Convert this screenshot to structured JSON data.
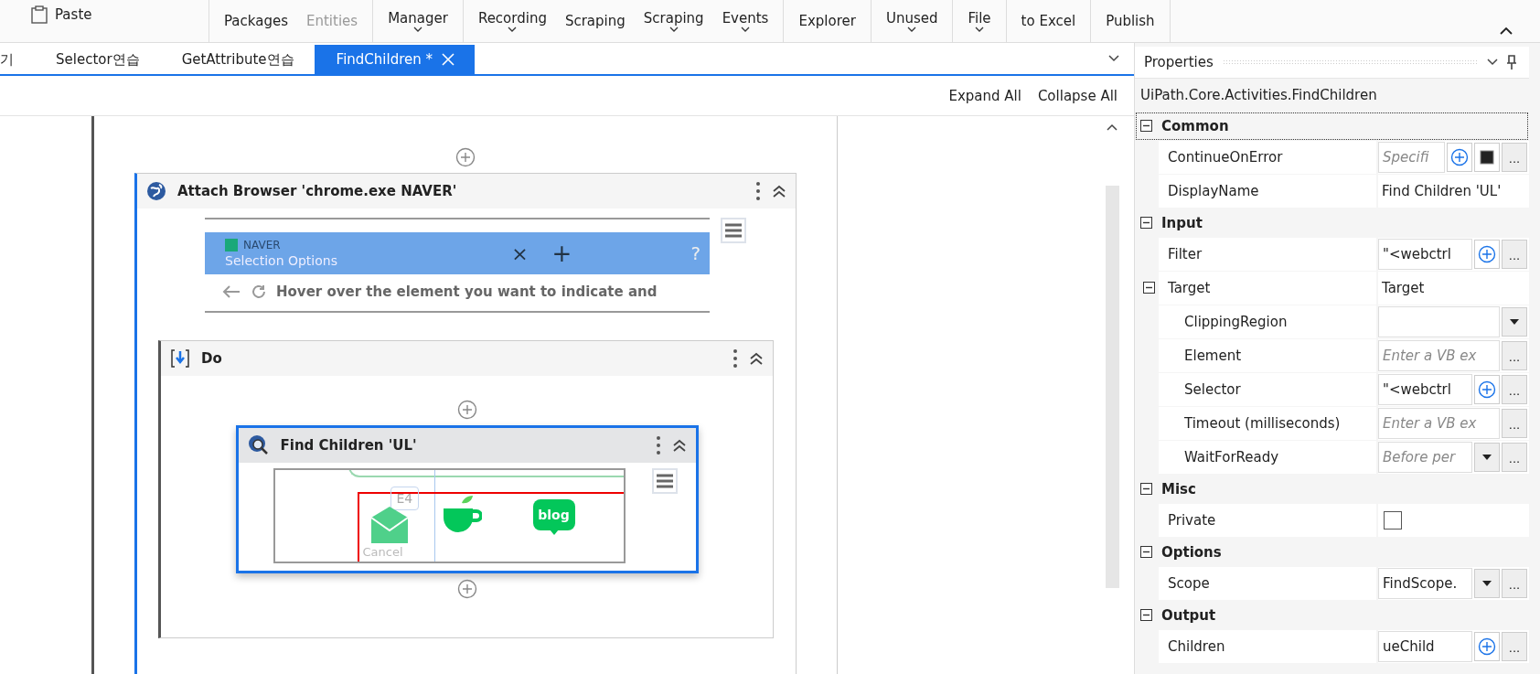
{
  "toolbar": {
    "groups": [
      [
        {
          "label": "Paste",
          "kind": "icon",
          "menu": false,
          "disabled": false
        }
      ],
      [
        {
          "label": "Packages",
          "kind": "text",
          "menu": false,
          "disabled": false
        },
        {
          "label": "Entities",
          "kind": "text",
          "menu": false,
          "disabled": true
        }
      ],
      [
        {
          "label": "Manager",
          "kind": "text",
          "menu": true,
          "disabled": false
        }
      ],
      [
        {
          "label": "Recording",
          "kind": "text",
          "menu": true,
          "disabled": false
        },
        {
          "label": "Scraping",
          "kind": "text",
          "menu": false,
          "disabled": false
        },
        {
          "label": "Scraping",
          "kind": "text",
          "menu": true,
          "disabled": false
        },
        {
          "label": "Events",
          "kind": "text",
          "menu": true,
          "disabled": false
        }
      ],
      [
        {
          "label": "Explorer",
          "kind": "text",
          "menu": false,
          "disabled": false
        }
      ],
      [
        {
          "label": "Unused",
          "kind": "text",
          "menu": true,
          "disabled": false
        }
      ],
      [
        {
          "label": "File",
          "kind": "text",
          "menu": true,
          "disabled": false
        }
      ],
      [
        {
          "label": "to Excel",
          "kind": "text",
          "menu": false,
          "disabled": false
        }
      ],
      [
        {
          "label": "Publish",
          "kind": "text",
          "menu": false,
          "disabled": false
        }
      ]
    ]
  },
  "tabs": [
    {
      "label": "기",
      "selected": false
    },
    {
      "label": "Selector연습",
      "selected": false
    },
    {
      "label": "GetAttribute연습",
      "selected": false
    },
    {
      "label": "FindChildren *",
      "selected": true
    }
  ],
  "designer": {
    "actions": [
      "Expand All",
      "Collapse All"
    ],
    "attach": {
      "title": "Attach Browser 'chrome.exe  NAVER'",
      "preview": {
        "tab_title": "NAVER",
        "overlay_title": "Selection Options",
        "close": "×",
        "new_tab": "+",
        "help": "?",
        "hint": "Hover over the element you want to indicate and"
      },
      "do": {
        "title": "Do",
        "find": {
          "title": "Find Children 'UL'",
          "selected": true,
          "preview": {
            "key_hint": "E4",
            "cancel": "Cancel",
            "logo_text": "blog"
          }
        }
      }
    }
  },
  "properties": {
    "title": "Properties",
    "type_name": "UiPath.Core.Activities.FindChildren",
    "categories": [
      {
        "name": "Common",
        "expanded": true,
        "selected": true,
        "items": [
          {
            "name": "ContinueOnError",
            "kind": "expr",
            "placeholder": "Specifi",
            "buttons": [
              {
                "kind": "add"
              },
              {
                "kind": "swatch"
              },
              {
                "kind": "more",
                "label": "..."
              }
            ]
          },
          {
            "name": "DisplayName",
            "kind": "text",
            "value": "Find Children 'UL'"
          }
        ]
      },
      {
        "name": "Input",
        "expanded": true,
        "selected": false,
        "items": [
          {
            "name": "Filter",
            "kind": "expr",
            "value": "\"<webctrl",
            "buttons": [
              {
                "kind": "add"
              },
              {
                "kind": "more",
                "label": "..."
              }
            ]
          },
          {
            "name": "Target",
            "kind": "text",
            "value": "Target",
            "expanded": true,
            "children": [
              {
                "name": "ClippingRegion",
                "kind": "expr",
                "buttons": [
                  {
                    "kind": "dropdown"
                  }
                ]
              },
              {
                "name": "Element",
                "kind": "expr",
                "placeholder": "Enter a VB ex",
                "buttons": [
                  {
                    "kind": "more",
                    "label": "..."
                  }
                ]
              },
              {
                "name": "Selector",
                "kind": "expr",
                "value": "\"<webctrl",
                "buttons": [
                  {
                    "kind": "add"
                  },
                  {
                    "kind": "more",
                    "label": "..."
                  }
                ]
              },
              {
                "name": "Timeout (milliseconds)",
                "kind": "expr",
                "placeholder": "Enter a VB ex",
                "buttons": [
                  {
                    "kind": "more",
                    "label": "..."
                  }
                ]
              },
              {
                "name": "WaitForReady",
                "kind": "expr",
                "placeholder": "Before per",
                "buttons": [
                  {
                    "kind": "dropdown"
                  },
                  {
                    "kind": "more",
                    "label": "..."
                  }
                ]
              }
            ]
          }
        ]
      },
      {
        "name": "Misc",
        "expanded": true,
        "selected": false,
        "items": [
          {
            "name": "Private",
            "kind": "checkbox",
            "checked": false
          }
        ]
      },
      {
        "name": "Options",
        "expanded": true,
        "selected": false,
        "items": [
          {
            "name": "Scope",
            "kind": "expr",
            "value": "FindScope.",
            "buttons": [
              {
                "kind": "dropdown"
              },
              {
                "kind": "more",
                "label": "..."
              }
            ]
          }
        ]
      },
      {
        "name": "Output",
        "expanded": true,
        "selected": false,
        "items": [
          {
            "name": "Children",
            "kind": "expr",
            "value": "ueChild",
            "buttons": [
              {
                "kind": "add"
              },
              {
                "kind": "more",
                "label": "..."
              }
            ]
          }
        ]
      }
    ]
  }
}
